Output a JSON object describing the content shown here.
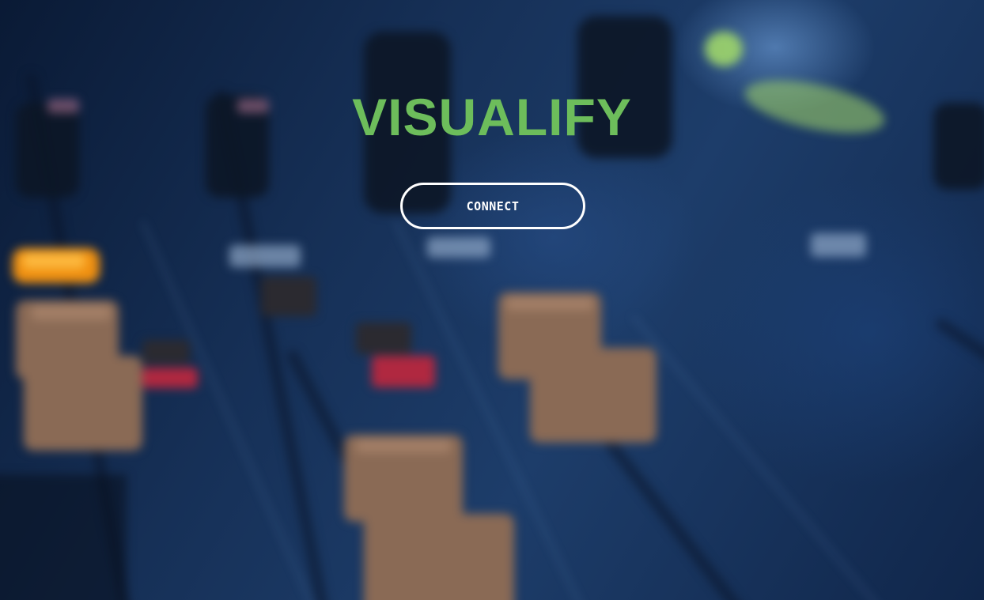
{
  "app": {
    "title": "VISUALIFY"
  },
  "actions": {
    "connect_label": "CONNECT"
  },
  "background": {
    "subject": "blurred audio mixing console faders",
    "tint": "#1b3a66"
  },
  "colors": {
    "brand_green": "#6dbd5b",
    "button_border": "#ffffff",
    "button_text": "#ffffff"
  }
}
